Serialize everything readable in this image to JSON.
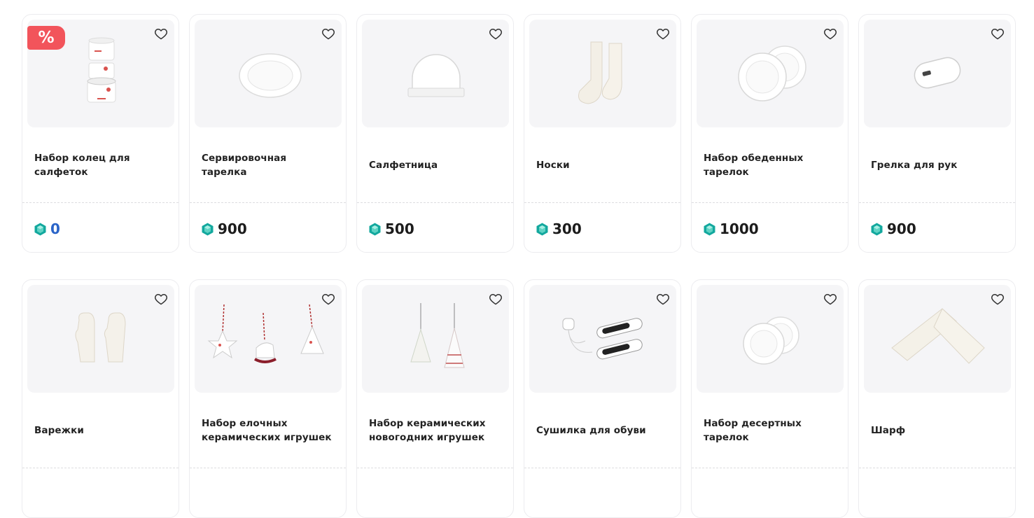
{
  "badge": {
    "label": "%"
  },
  "products": [
    {
      "title": "Набор колец для салфеток",
      "price": "0",
      "sale": true,
      "image": "napkin-rings"
    },
    {
      "title": "Сервировочная тарелка",
      "price": "900",
      "sale": false,
      "image": "serving-plate"
    },
    {
      "title": "Салфетница",
      "price": "500",
      "sale": false,
      "image": "napkin-holder"
    },
    {
      "title": "Носки",
      "price": "300",
      "sale": false,
      "image": "socks"
    },
    {
      "title": "Набор обеденных тарелок",
      "price": "1000",
      "sale": false,
      "image": "dinner-plates"
    },
    {
      "title": "Грелка для рук",
      "price": "900",
      "sale": false,
      "image": "hand-warmer"
    },
    {
      "title": "Варежки",
      "price": "",
      "sale": false,
      "image": "mittens"
    },
    {
      "title": "Набор елочных керамических игрушек",
      "price": "",
      "sale": false,
      "image": "ceramic-ornaments"
    },
    {
      "title": "Набор керамических новогодних игрушек",
      "price": "",
      "sale": false,
      "image": "ceramic-trees"
    },
    {
      "title": "Сушилка для обуви",
      "price": "",
      "sale": false,
      "image": "shoe-dryer"
    },
    {
      "title": "Набор десертных тарелок",
      "price": "",
      "sale": false,
      "image": "dessert-plates"
    },
    {
      "title": "Шарф",
      "price": "",
      "sale": false,
      "image": "scarf"
    }
  ],
  "icons": {
    "favorite": "heart-outline-icon",
    "currency": "gem-icon"
  },
  "colors": {
    "sale_badge": "#f2545b",
    "gem": "#13a89e",
    "zero_price": "#2a64c8",
    "image_bg": "#f5f5f7"
  }
}
